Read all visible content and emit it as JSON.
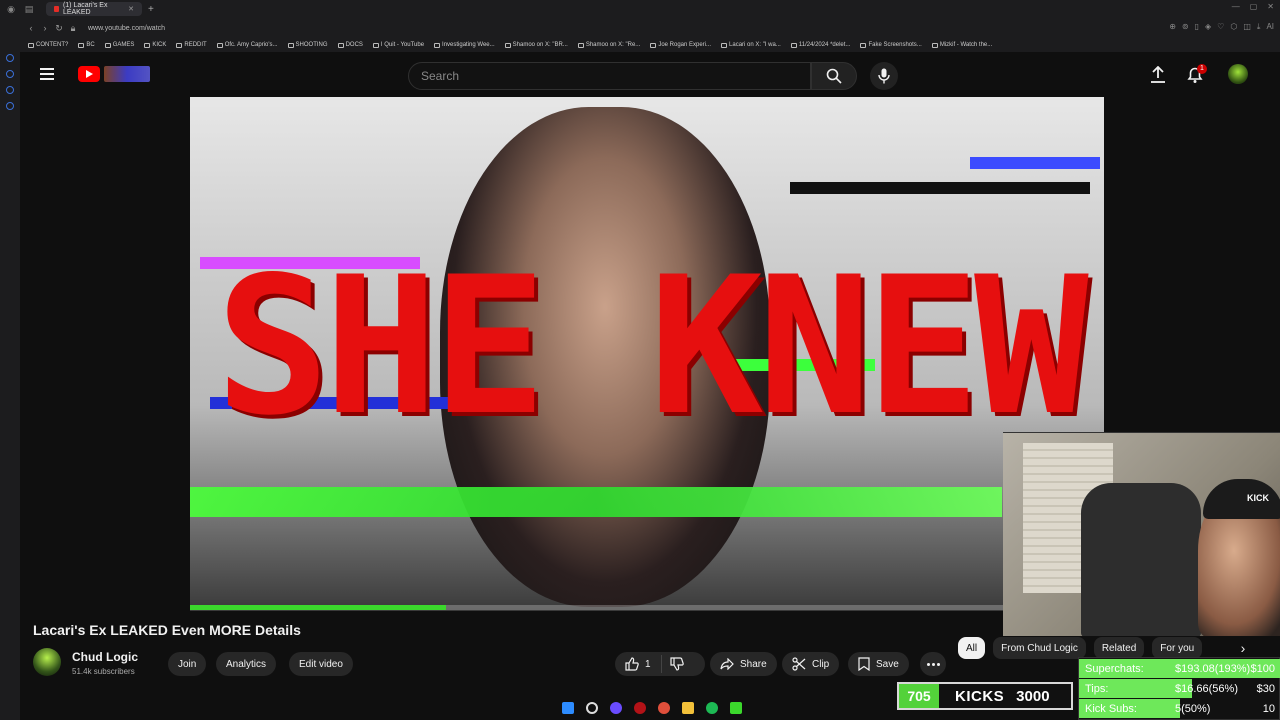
{
  "browser": {
    "tab_title": "(1) Lacari's Ex LEAKED",
    "url": "www.youtube.com/watch",
    "bookmarks": [
      "CONTENT?",
      "BC",
      "GAMES",
      "KICK",
      "REDDIT",
      "Ofc. Amy Caprio's...",
      "SHOOTING",
      "DOCS",
      "I Quit - YouTube",
      "Investigating Wee...",
      "Shamoo on X: \"BR...",
      "Shamoo on X: \"Re...",
      "Joe Rogan Experi...",
      "Lacari on X: \"I wa...",
      "11/24/2024 *delet...",
      "Fake Screenshots...",
      "Mizkif - Watch the..."
    ]
  },
  "header": {
    "search_placeholder": "Search",
    "notification_count": "1"
  },
  "video": {
    "headline_text": "SHE KNEW",
    "progress_fraction": 0.28
  },
  "webcam": {
    "cap_text": "KICK"
  },
  "watch": {
    "title": "Lacari's Ex LEAKED Even MORE Details",
    "channel_name": "Chud Logic",
    "subscribers": "51.4k subscribers",
    "join_label": "Join",
    "analytics_label": "Analytics",
    "edit_label": "Edit video",
    "like_count": "1",
    "share_label": "Share",
    "clip_label": "Clip",
    "save_label": "Save"
  },
  "chips": [
    "All",
    "From Chud Logic",
    "Related",
    "For you"
  ],
  "overlay": {
    "kicks_count": "705",
    "kicks_label": "KICKS",
    "kicks_goal": "3000",
    "superchats": [
      {
        "label": "Superchats:",
        "value": "$193.08(193%)",
        "goal": "$100",
        "fraction": 1.0
      },
      {
        "label": "Tips:",
        "value": "$16.66(56%)",
        "goal": "$30",
        "fraction": 0.56
      },
      {
        "label": "Kick Subs:",
        "value": "5(50%)",
        "goal": "10",
        "fraction": 0.5
      }
    ]
  },
  "colors": {
    "accent_red": "#ff0000",
    "headline_red": "#e60f0f",
    "progress_green": "#3bd82c",
    "overlay_green": "#6ee85a"
  }
}
